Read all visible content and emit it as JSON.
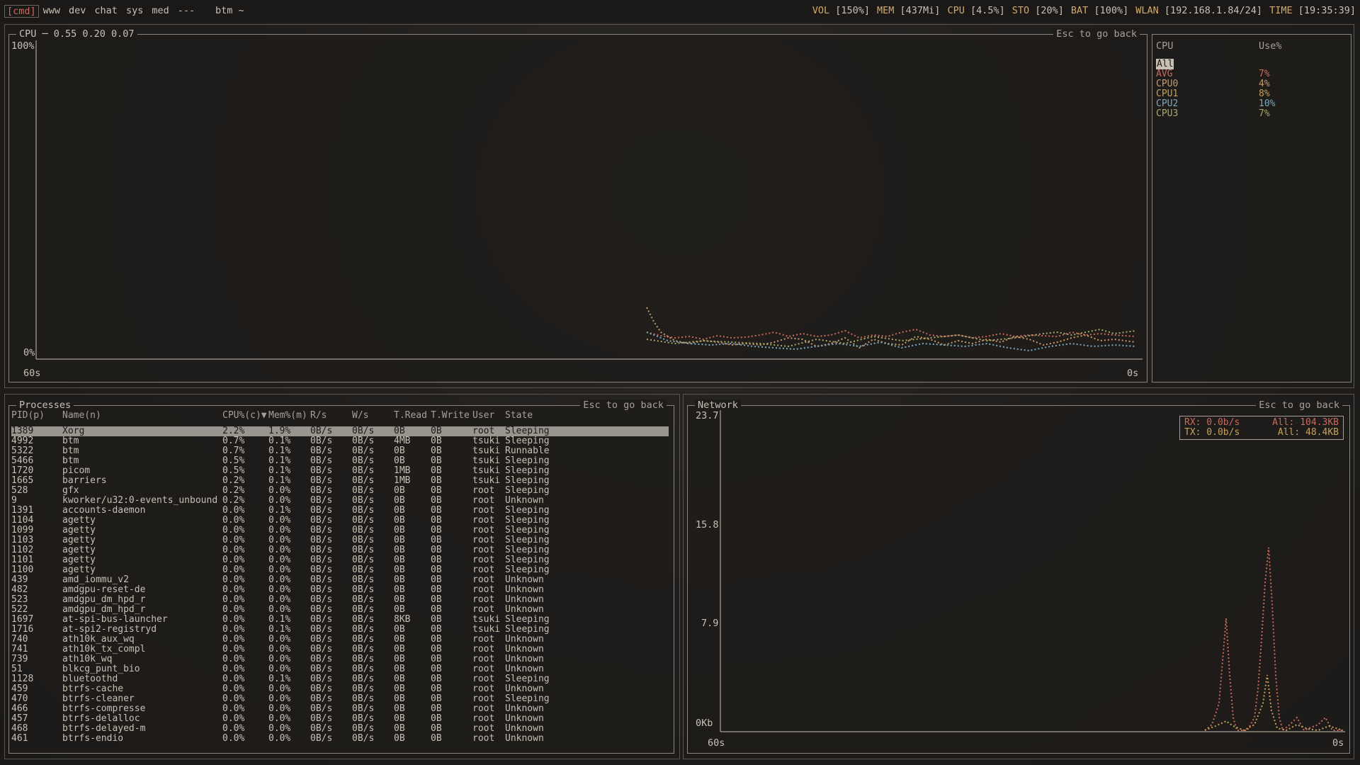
{
  "topbar": {
    "tags": [
      {
        "label": "[cmd]",
        "active": true
      },
      {
        "label": "www",
        "active": false
      },
      {
        "label": "dev",
        "active": false
      },
      {
        "label": "chat",
        "active": false
      },
      {
        "label": "sys",
        "active": false
      },
      {
        "label": "med",
        "active": false
      },
      {
        "label": "---",
        "active": false
      }
    ],
    "window_title": "btm ~",
    "status": [
      {
        "label": "VOL",
        "value": "[150%]"
      },
      {
        "label": "MEM",
        "value": "[437Mi]"
      },
      {
        "label": "CPU",
        "value": "[4.5%]"
      },
      {
        "label": "STO",
        "value": "[20%]"
      },
      {
        "label": "BAT",
        "value": "[100%]"
      },
      {
        "label": "WLAN",
        "value": "[192.168.1.84/24]"
      },
      {
        "label": "TIME",
        "value": "[19:35:39]"
      }
    ]
  },
  "cpu": {
    "title": "CPU ─ 0.55 0.20 0.07",
    "hint": "Esc to go back",
    "y_top": "100%",
    "y_bottom": "0%",
    "x_left": "60s",
    "x_right": "0s"
  },
  "cpu_legend": {
    "col_cpu": "CPU",
    "col_use": "Use%",
    "rows": [
      {
        "name": "All",
        "value": "",
        "color": "#c8c0b4",
        "selected": true
      },
      {
        "name": "AVG",
        "value": "7%",
        "color": "#c86a5c"
      },
      {
        "name": "CPU0",
        "value": "4%",
        "color": "#c89a6a"
      },
      {
        "name": "CPU1",
        "value": "8%",
        "color": "#c8a05a"
      },
      {
        "name": "CPU2",
        "value": "10%",
        "color": "#7aa8c0"
      },
      {
        "name": "CPU3",
        "value": "7%",
        "color": "#a8a868"
      }
    ]
  },
  "processes": {
    "title": "Processes",
    "hint": "Esc to go back",
    "headers": [
      "PID(p)",
      "Name(n)",
      "CPU%(c)▼",
      "Mem%(m)",
      "R/s",
      "W/s",
      "T.Read",
      "T.Write",
      "User",
      "State"
    ],
    "rows": [
      [
        "1389",
        "Xorg",
        "2.2%",
        "1.9%",
        "0B/s",
        "0B/s",
        "0B",
        "0B",
        "root",
        "Sleeping"
      ],
      [
        "4992",
        "btm",
        "0.7%",
        "0.1%",
        "0B/s",
        "0B/s",
        "4MB",
        "0B",
        "tsuki",
        "Sleeping"
      ],
      [
        "5322",
        "btm",
        "0.7%",
        "0.1%",
        "0B/s",
        "0B/s",
        "0B",
        "0B",
        "tsuki",
        "Runnable"
      ],
      [
        "5466",
        "btm",
        "0.5%",
        "0.1%",
        "0B/s",
        "0B/s",
        "0B",
        "0B",
        "tsuki",
        "Sleeping"
      ],
      [
        "1720",
        "picom",
        "0.5%",
        "0.1%",
        "0B/s",
        "0B/s",
        "1MB",
        "0B",
        "tsuki",
        "Sleeping"
      ],
      [
        "1665",
        "barriers",
        "0.2%",
        "0.1%",
        "0B/s",
        "0B/s",
        "1MB",
        "0B",
        "tsuki",
        "Sleeping"
      ],
      [
        "528",
        "gfx",
        "0.2%",
        "0.0%",
        "0B/s",
        "0B/s",
        "0B",
        "0B",
        "root",
        "Sleeping"
      ],
      [
        "9",
        "kworker/u32:0-events_unbound",
        "0.2%",
        "0.0%",
        "0B/s",
        "0B/s",
        "0B",
        "0B",
        "root",
        "Unknown"
      ],
      [
        "1391",
        "accounts-daemon",
        "0.0%",
        "0.1%",
        "0B/s",
        "0B/s",
        "0B",
        "0B",
        "root",
        "Sleeping"
      ],
      [
        "1104",
        "agetty",
        "0.0%",
        "0.0%",
        "0B/s",
        "0B/s",
        "0B",
        "0B",
        "root",
        "Sleeping"
      ],
      [
        "1099",
        "agetty",
        "0.0%",
        "0.0%",
        "0B/s",
        "0B/s",
        "0B",
        "0B",
        "root",
        "Sleeping"
      ],
      [
        "1103",
        "agetty",
        "0.0%",
        "0.0%",
        "0B/s",
        "0B/s",
        "0B",
        "0B",
        "root",
        "Sleeping"
      ],
      [
        "1102",
        "agetty",
        "0.0%",
        "0.0%",
        "0B/s",
        "0B/s",
        "0B",
        "0B",
        "root",
        "Sleeping"
      ],
      [
        "1101",
        "agetty",
        "0.0%",
        "0.0%",
        "0B/s",
        "0B/s",
        "0B",
        "0B",
        "root",
        "Sleeping"
      ],
      [
        "1100",
        "agetty",
        "0.0%",
        "0.0%",
        "0B/s",
        "0B/s",
        "0B",
        "0B",
        "root",
        "Sleeping"
      ],
      [
        "439",
        "amd_iommu_v2",
        "0.0%",
        "0.0%",
        "0B/s",
        "0B/s",
        "0B",
        "0B",
        "root",
        "Unknown"
      ],
      [
        "482",
        "amdgpu-reset-de",
        "0.0%",
        "0.0%",
        "0B/s",
        "0B/s",
        "0B",
        "0B",
        "root",
        "Unknown"
      ],
      [
        "523",
        "amdgpu_dm_hpd_r",
        "0.0%",
        "0.0%",
        "0B/s",
        "0B/s",
        "0B",
        "0B",
        "root",
        "Unknown"
      ],
      [
        "522",
        "amdgpu_dm_hpd_r",
        "0.0%",
        "0.0%",
        "0B/s",
        "0B/s",
        "0B",
        "0B",
        "root",
        "Unknown"
      ],
      [
        "1697",
        "at-spi-bus-launcher",
        "0.0%",
        "0.1%",
        "0B/s",
        "0B/s",
        "8KB",
        "0B",
        "tsuki",
        "Sleeping"
      ],
      [
        "1716",
        "at-spi2-registryd",
        "0.0%",
        "0.1%",
        "0B/s",
        "0B/s",
        "0B",
        "0B",
        "tsuki",
        "Sleeping"
      ],
      [
        "740",
        "ath10k_aux_wq",
        "0.0%",
        "0.0%",
        "0B/s",
        "0B/s",
        "0B",
        "0B",
        "root",
        "Unknown"
      ],
      [
        "741",
        "ath10k_tx_compl",
        "0.0%",
        "0.0%",
        "0B/s",
        "0B/s",
        "0B",
        "0B",
        "root",
        "Unknown"
      ],
      [
        "739",
        "ath10k_wq",
        "0.0%",
        "0.0%",
        "0B/s",
        "0B/s",
        "0B",
        "0B",
        "root",
        "Unknown"
      ],
      [
        "51",
        "blkcg_punt_bio",
        "0.0%",
        "0.0%",
        "0B/s",
        "0B/s",
        "0B",
        "0B",
        "root",
        "Unknown"
      ],
      [
        "1128",
        "bluetoothd",
        "0.0%",
        "0.1%",
        "0B/s",
        "0B/s",
        "0B",
        "0B",
        "root",
        "Sleeping"
      ],
      [
        "459",
        "btrfs-cache",
        "0.0%",
        "0.0%",
        "0B/s",
        "0B/s",
        "0B",
        "0B",
        "root",
        "Unknown"
      ],
      [
        "470",
        "btrfs-cleaner",
        "0.0%",
        "0.0%",
        "0B/s",
        "0B/s",
        "0B",
        "0B",
        "root",
        "Sleeping"
      ],
      [
        "466",
        "btrfs-compresse",
        "0.0%",
        "0.0%",
        "0B/s",
        "0B/s",
        "0B",
        "0B",
        "root",
        "Unknown"
      ],
      [
        "457",
        "btrfs-delalloc",
        "0.0%",
        "0.0%",
        "0B/s",
        "0B/s",
        "0B",
        "0B",
        "root",
        "Unknown"
      ],
      [
        "468",
        "btrfs-delayed-m",
        "0.0%",
        "0.0%",
        "0B/s",
        "0B/s",
        "0B",
        "0B",
        "root",
        "Unknown"
      ],
      [
        "461",
        "btrfs-endio",
        "0.0%",
        "0.0%",
        "0B/s",
        "0B/s",
        "0B",
        "0B",
        "root",
        "Unknown"
      ]
    ]
  },
  "network": {
    "title": "Network",
    "hint": "Esc to go back",
    "y_labels": [
      "23.7",
      "15.8",
      "7.9",
      "0Kb"
    ],
    "x_left": "60s",
    "x_right": "0s",
    "rx": "RX: 0.0b/s",
    "tx": "TX: 0.0b/s",
    "rx_all": "All: 104.3KB",
    "tx_all": "All: 48.4KB"
  }
}
